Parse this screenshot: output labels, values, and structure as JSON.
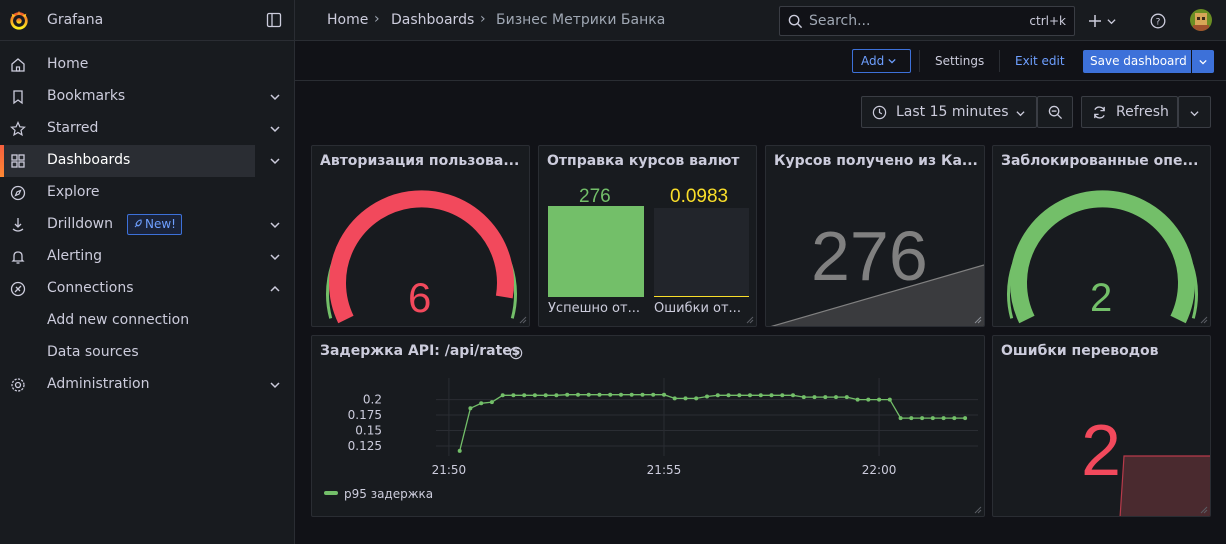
{
  "app": {
    "title": "Grafana"
  },
  "breadcrumb": {
    "home": "Home",
    "dashboards": "Dashboards",
    "current": "Бизнес Метрики Банка"
  },
  "search": {
    "placeholder": "Search...",
    "shortcut": "ctrl+k"
  },
  "sidebar": {
    "items": [
      {
        "label": "Home",
        "icon": "home-icon"
      },
      {
        "label": "Bookmarks",
        "icon": "bookmark-icon"
      },
      {
        "label": "Starred",
        "icon": "star-icon"
      },
      {
        "label": "Dashboards",
        "icon": "apps-icon"
      },
      {
        "label": "Explore",
        "icon": "compass-icon"
      },
      {
        "label": "Drilldown",
        "icon": "drilldown-icon",
        "badge": "New!"
      },
      {
        "label": "Alerting",
        "icon": "bell-icon"
      },
      {
        "label": "Connections",
        "icon": "connections-icon"
      },
      {
        "label": "Administration",
        "icon": "cog-icon"
      }
    ],
    "connections_sub": [
      "Add new connection",
      "Data sources"
    ]
  },
  "toolbar": {
    "add": "Add",
    "settings": "Settings",
    "exit_edit": "Exit edit",
    "save": "Save dashboard"
  },
  "time": {
    "range": "Last 15 minutes",
    "refresh": "Refresh"
  },
  "colors": {
    "green": "#73bf69",
    "red": "#f2495c",
    "yellow": "#fade2a",
    "accent": "#3d71d9",
    "gray": "#808080"
  },
  "panels": {
    "auth": {
      "title": "Авторизация пользова...",
      "value": "6",
      "gauge_fraction": 0.93
    },
    "rates_sent": {
      "title": "Отправка курсов валют",
      "bars": [
        {
          "label": "Успешно от...",
          "value": "276",
          "fill": 1.0
        },
        {
          "label": "Ошибки от...",
          "value": "0.0983",
          "fill": 0.0
        }
      ]
    },
    "rates_received": {
      "title": "Курсов получено из Ка...",
      "value": "276"
    },
    "blocked": {
      "title": "Заблокированные опе...",
      "value": "2",
      "gauge_fraction": 1.0
    },
    "latency": {
      "title": "Задержка API: /api/rates",
      "legend": "p95 задержка"
    },
    "transfer_errors": {
      "title": "Ошибки переводов",
      "value": "2"
    }
  },
  "chart_data": {
    "type": "line",
    "title": "Задержка API: /api/rates",
    "x_ticks": [
      "21:50",
      "21:55",
      "22:00"
    ],
    "y_ticks": [
      "0.2",
      "0.175",
      "0.15",
      "0.125"
    ],
    "ylim": [
      0.112,
      0.222
    ],
    "xlim_minutes": [
      -0.3,
      12.3
    ],
    "grid": true,
    "legend_placement": "bottom-left",
    "series": [
      {
        "name": "p95 задержка",
        "color": "#73bf69",
        "x_minutes": [
          0.25,
          0.5,
          0.75,
          1.0,
          1.25,
          1.5,
          1.75,
          2.0,
          2.25,
          2.5,
          2.75,
          3.0,
          3.25,
          3.5,
          3.75,
          4.0,
          4.25,
          4.5,
          4.75,
          5.0,
          5.25,
          5.5,
          5.75,
          6.0,
          6.25,
          6.5,
          6.75,
          7.0,
          7.25,
          7.5,
          7.75,
          8.0,
          8.25,
          8.5,
          8.75,
          9.0,
          9.25,
          9.5,
          9.75,
          10.0,
          10.25,
          10.5,
          10.75,
          11.0,
          11.25,
          11.5,
          11.75,
          12.0
        ],
        "y": [
          0.117,
          0.186,
          0.194,
          0.196,
          0.207,
          0.207,
          0.207,
          0.207,
          0.207,
          0.207,
          0.208,
          0.208,
          0.208,
          0.208,
          0.208,
          0.208,
          0.208,
          0.208,
          0.208,
          0.208,
          0.202,
          0.202,
          0.202,
          0.205,
          0.207,
          0.207,
          0.207,
          0.207,
          0.207,
          0.207,
          0.207,
          0.207,
          0.204,
          0.204,
          0.204,
          0.204,
          0.204,
          0.2,
          0.2,
          0.2,
          0.2,
          0.17,
          0.17,
          0.17,
          0.17,
          0.17,
          0.17,
          0.17,
          0.17
        ]
      }
    ]
  }
}
